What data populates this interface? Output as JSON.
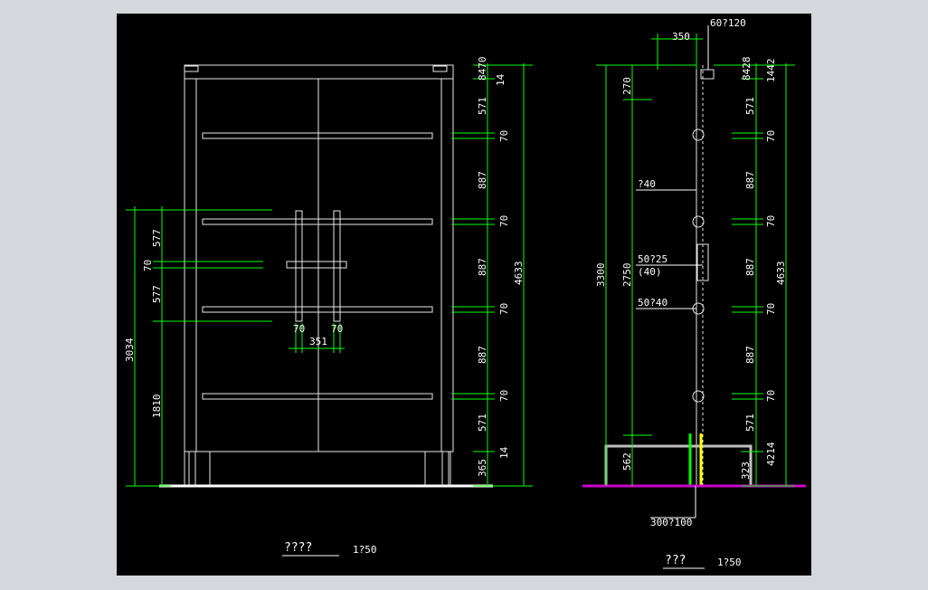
{
  "drawing": {
    "elevation_front": {
      "title": "????",
      "scale": "1?50",
      "dims_right": [
        "8470",
        "14",
        "571",
        "70",
        "887",
        "70",
        "887",
        "70",
        "887",
        "70",
        "571",
        "14",
        "365"
      ],
      "dim_total_right": "4633",
      "dims_left": [
        "577",
        "70",
        "577",
        "1810"
      ],
      "dim_total_left": "3034",
      "dims_handle": [
        "70",
        "351",
        "70"
      ]
    },
    "elevation_side": {
      "title": "???",
      "scale": "1?50",
      "dim_top": "350",
      "label_top": "60?120",
      "dims_left": [
        "270",
        "2750",
        "562"
      ],
      "dim_total_left": "3300",
      "labels": [
        "?40",
        "50?25",
        "(40)",
        "50?40",
        "300?100"
      ],
      "dims_right": [
        "8428",
        "1442",
        "571",
        "70",
        "887",
        "70",
        "887",
        "70",
        "887",
        "70",
        "571",
        "4214",
        "323"
      ],
      "dim_total_right": "4633"
    }
  },
  "colors": {
    "background": "#000000",
    "dimension": "#00ff00",
    "outline": "#e8e8e8",
    "ground": "#cc00cc",
    "post": "#ffff00",
    "frame": "#c0c0c0"
  }
}
